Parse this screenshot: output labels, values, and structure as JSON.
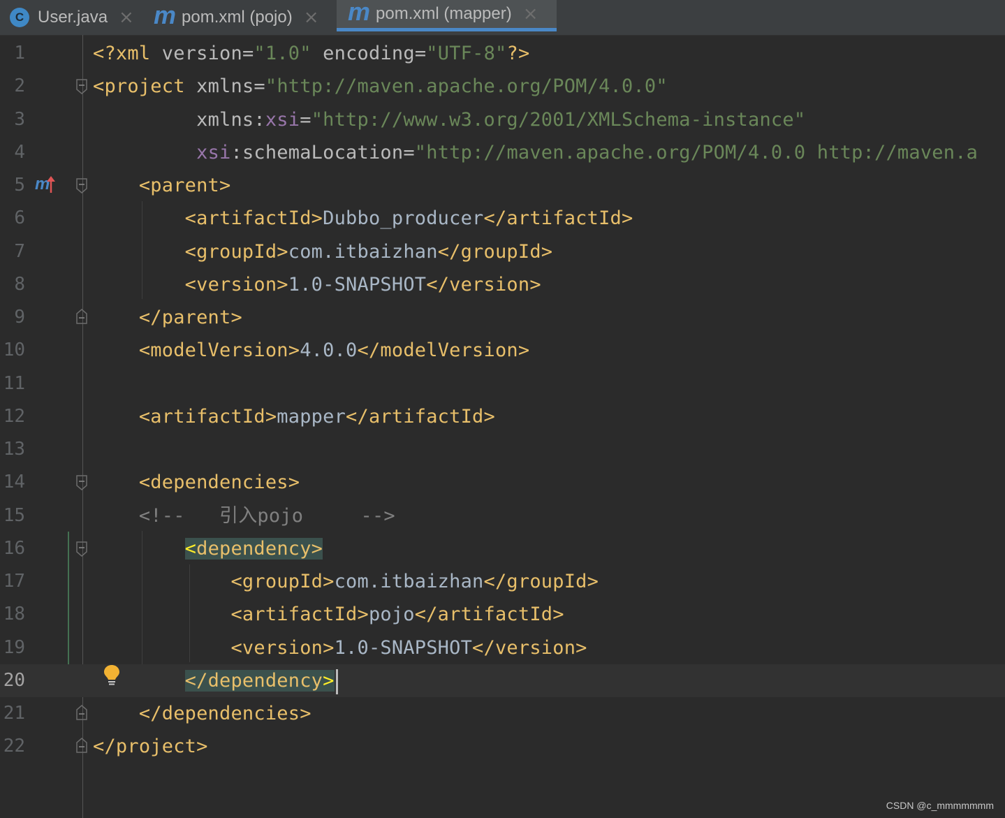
{
  "tabs": [
    {
      "label": "User.java",
      "icon": "c-class-icon",
      "active": false
    },
    {
      "label": "pom.xml (pojo)",
      "icon": "maven-icon",
      "active": false
    },
    {
      "label": "pom.xml (mapper)",
      "icon": "maven-icon",
      "active": true
    }
  ],
  "tab_icon_text": {
    "class": "C",
    "maven": "m"
  },
  "editor": {
    "current_line": 20,
    "lines": [
      {
        "n": "1"
      },
      {
        "n": "2"
      },
      {
        "n": "3"
      },
      {
        "n": "4"
      },
      {
        "n": "5"
      },
      {
        "n": "6"
      },
      {
        "n": "7"
      },
      {
        "n": "8"
      },
      {
        "n": "9"
      },
      {
        "n": "10"
      },
      {
        "n": "11"
      },
      {
        "n": "12"
      },
      {
        "n": "13"
      },
      {
        "n": "14"
      },
      {
        "n": "15"
      },
      {
        "n": "16"
      },
      {
        "n": "17"
      },
      {
        "n": "18"
      },
      {
        "n": "19"
      },
      {
        "n": "20"
      },
      {
        "n": "21"
      },
      {
        "n": "22"
      }
    ],
    "code": {
      "l1": {
        "open": "<?xml",
        "attr1": "version",
        "eq1": "=",
        "val1": "\"1.0\"",
        "attr2": "encoding",
        "eq2": "=",
        "val2": "\"UTF-8\"",
        "close": "?>"
      },
      "l2": {
        "open": "<project",
        "attr": "xmlns",
        "eq": "=",
        "val": "\"http://maven.apache.org/POM/4.0.0\""
      },
      "l3": {
        "attr": "xmlns:",
        "ns": "xsi",
        "eq": "=",
        "val": "\"http://www.w3.org/2001/XMLSchema-instance\""
      },
      "l4": {
        "ns": "xsi",
        "attr": ":schemaLocation",
        "eq": "=",
        "val": "\"http://maven.apache.org/POM/4.0.0 http://maven.a"
      },
      "l5": {
        "tag": "<parent>"
      },
      "l6": {
        "open": "<artifactId>",
        "text": "Dubbo_producer",
        "close": "</artifactId>"
      },
      "l7": {
        "open": "<groupId>",
        "text": "com.itbaizhan",
        "close": "</groupId>"
      },
      "l8": {
        "open": "<version>",
        "text": "1.0-SNAPSHOT",
        "close": "</version>"
      },
      "l9": {
        "tag": "</parent>"
      },
      "l10": {
        "open": "<modelVersion>",
        "text": "4.0.0",
        "close": "</modelVersion>"
      },
      "l12": {
        "open": "<artifactId>",
        "text": "mapper",
        "close": "</artifactId>"
      },
      "l14": {
        "tag": "<dependencies>"
      },
      "l15": {
        "comment": "<!--   引入pojo     -->"
      },
      "l16": {
        "lt": "<",
        "tag": "dependency>"
      },
      "l17": {
        "open": "<groupId>",
        "text": "com.itbaizhan",
        "close": "</groupId>"
      },
      "l18": {
        "open": "<artifactId>",
        "text": "pojo",
        "close": "</artifactId>"
      },
      "l19": {
        "open": "<version>",
        "text": "1.0-SNAPSHOT",
        "close": "</version>"
      },
      "l20": {
        "tag": "</dependency",
        "gt": ">"
      },
      "l21": {
        "tag": "</dependencies>"
      },
      "l22": {
        "tag": "</project>"
      }
    }
  },
  "gutter": {
    "maven_marker": "m",
    "marker_icon": "maven-parent-arrow-icon",
    "intention_icon": "lightbulb-icon"
  },
  "watermark": "CSDN @c_mmmmmmm",
  "colors": {
    "tag": "#e8bf6a",
    "string": "#6a8759",
    "namespace": "#9876aa",
    "comment": "#808080",
    "text": "#a9b7c6",
    "background": "#2b2b2b",
    "accent": "#4a88c7"
  }
}
